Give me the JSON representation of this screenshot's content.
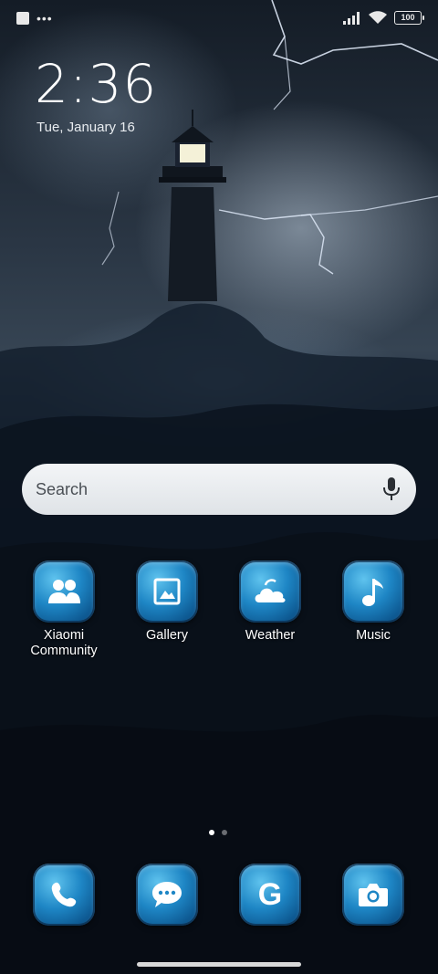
{
  "status_bar": {
    "left_icons": [
      "notification-square-icon",
      "more-dots-icon"
    ],
    "right_icons": [
      "signal-icon",
      "wifi-icon",
      "battery-icon"
    ],
    "battery_level": "100"
  },
  "clock": {
    "time": "2:36",
    "date": "Tue, January 16"
  },
  "search": {
    "placeholder": "Search",
    "icon": "mic-icon"
  },
  "apps": [
    {
      "label": "Xiaomi\nCommunity",
      "icon": "community-icon"
    },
    {
      "label": "Gallery",
      "icon": "gallery-icon"
    },
    {
      "label": "Weather",
      "icon": "weather-icon"
    },
    {
      "label": "Music",
      "icon": "music-icon"
    }
  ],
  "dock": [
    {
      "icon": "phone-icon"
    },
    {
      "icon": "messages-icon"
    },
    {
      "icon": "google-icon",
      "glyph": "G"
    },
    {
      "icon": "camera-icon"
    }
  ],
  "page_indicator": {
    "pages": 2,
    "current": 1
  }
}
